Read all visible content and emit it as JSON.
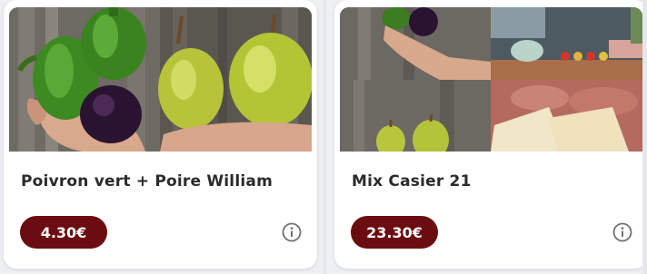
{
  "colors": {
    "price_badge": "#6b0c10",
    "title_text": "#2b2b2b",
    "info_icon": "#6f6f6f"
  },
  "products": [
    {
      "title": "Poivron vert + Poire William",
      "price": "4.30€",
      "image_icon": "peppers-and-pears-photo",
      "info_icon": "info-circle-icon"
    },
    {
      "title": "Mix Casier 21",
      "price": "23.30€",
      "image_icon": "mixed-produce-collage-photo",
      "info_icon": "info-circle-icon"
    }
  ]
}
